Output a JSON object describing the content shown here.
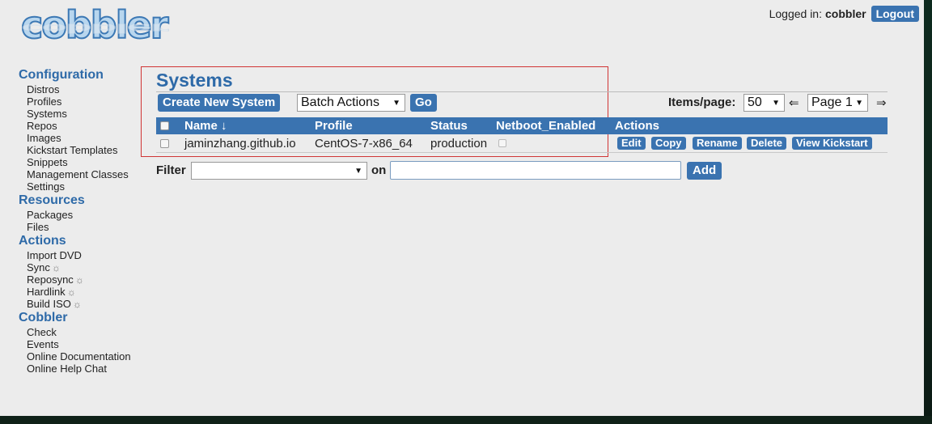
{
  "logo": {
    "text": "cobbler"
  },
  "login": {
    "label": "Logged in:",
    "user": "cobbler",
    "logout_label": "Logout"
  },
  "sidebar": {
    "configuration": {
      "heading": "Configuration",
      "items": [
        "Distros",
        "Profiles",
        "Systems",
        "Repos",
        "Images",
        "Kickstart Templates",
        "Snippets",
        "Management Classes",
        "Settings"
      ]
    },
    "resources": {
      "heading": "Resources",
      "items": [
        "Packages",
        "Files"
      ]
    },
    "actions": {
      "heading": "Actions",
      "items": [
        "Import DVD",
        "Sync",
        "Reposync",
        "Hardlink",
        "Build ISO"
      ]
    },
    "cobbler": {
      "heading": "Cobbler",
      "items": [
        "Check",
        "Events",
        "Online Documentation",
        "Online Help Chat"
      ]
    }
  },
  "main": {
    "title": "Systems",
    "create_label": "Create New System",
    "batch_select": "Batch Actions",
    "go_label": "Go",
    "items_per_page_label": "Items/page:",
    "items_per_page": "50",
    "prev_arrow": "⇐",
    "page_select": "Page 1",
    "next_arrow": "⇒",
    "columns": {
      "name": "Name ↓",
      "profile": "Profile",
      "status": "Status",
      "netboot": "Netboot_Enabled",
      "actions": "Actions"
    },
    "rows": [
      {
        "name": "jaminzhang.github.io",
        "profile": "CentOS-7-x86_64",
        "status": "production",
        "actions": [
          "Edit",
          "Copy",
          "Rename",
          "Delete",
          "View Kickstart"
        ]
      }
    ],
    "filter": {
      "label": "Filter",
      "select_value": "",
      "on_label": "on",
      "input_value": "",
      "add_label": "Add"
    }
  },
  "colors": {
    "accent": "#3a73b0",
    "heading": "#2e6aa8",
    "highlight_box": "#d03535"
  }
}
